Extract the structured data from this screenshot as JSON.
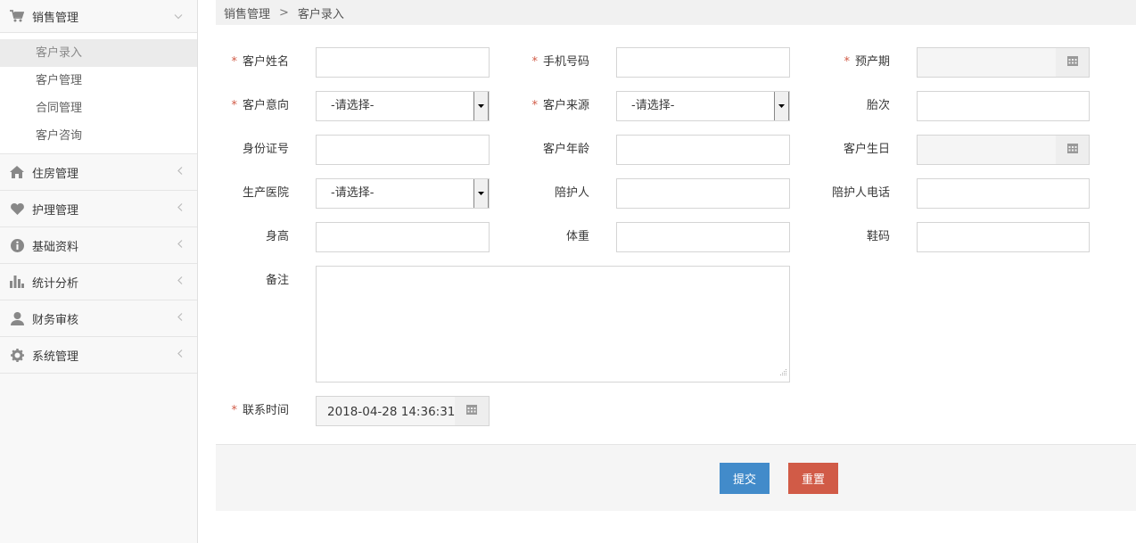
{
  "sidebar": {
    "sales": {
      "label": "销售管理",
      "items": [
        {
          "label": "客户录入"
        },
        {
          "label": "客户管理"
        },
        {
          "label": "合同管理"
        },
        {
          "label": "客户咨询"
        }
      ]
    },
    "groups": [
      {
        "label": "住房管理",
        "icon": "home-icon"
      },
      {
        "label": "护理管理",
        "icon": "heart-icon"
      },
      {
        "label": "基础资料",
        "icon": "info-icon"
      },
      {
        "label": "统计分析",
        "icon": "bar-chart-icon"
      },
      {
        "label": "财务审核",
        "icon": "user-icon"
      },
      {
        "label": "系统管理",
        "icon": "gear-icon"
      }
    ]
  },
  "breadcrumb": {
    "parent": "销售管理",
    "separator": ">",
    "current": "客户录入"
  },
  "form": {
    "required_mark": "*",
    "customer_name": {
      "label": "客户姓名"
    },
    "phone": {
      "label": "手机号码"
    },
    "due_date": {
      "label": "预产期"
    },
    "intention": {
      "label": "客户意向",
      "value": "-请选择-"
    },
    "source": {
      "label": "客户来源",
      "value": "-请选择-"
    },
    "parity": {
      "label": "胎次"
    },
    "id_number": {
      "label": "身份证号"
    },
    "age": {
      "label": "客户年龄"
    },
    "birthday": {
      "label": "客户生日"
    },
    "hospital": {
      "label": "生产医院",
      "value": "-请选择-"
    },
    "companion": {
      "label": "陪护人"
    },
    "companion_phone": {
      "label": "陪护人电话"
    },
    "height": {
      "label": "身高"
    },
    "weight": {
      "label": "体重"
    },
    "shoe_size": {
      "label": "鞋码"
    },
    "remark": {
      "label": "备注"
    },
    "contact_time": {
      "label": "联系时间",
      "value": "2018-04-28 14:36:31"
    }
  },
  "actions": {
    "submit": "提交",
    "reset": "重置"
  },
  "colors": {
    "required": "#d15b47",
    "submit": "#428bca",
    "reset": "#d15b47"
  }
}
